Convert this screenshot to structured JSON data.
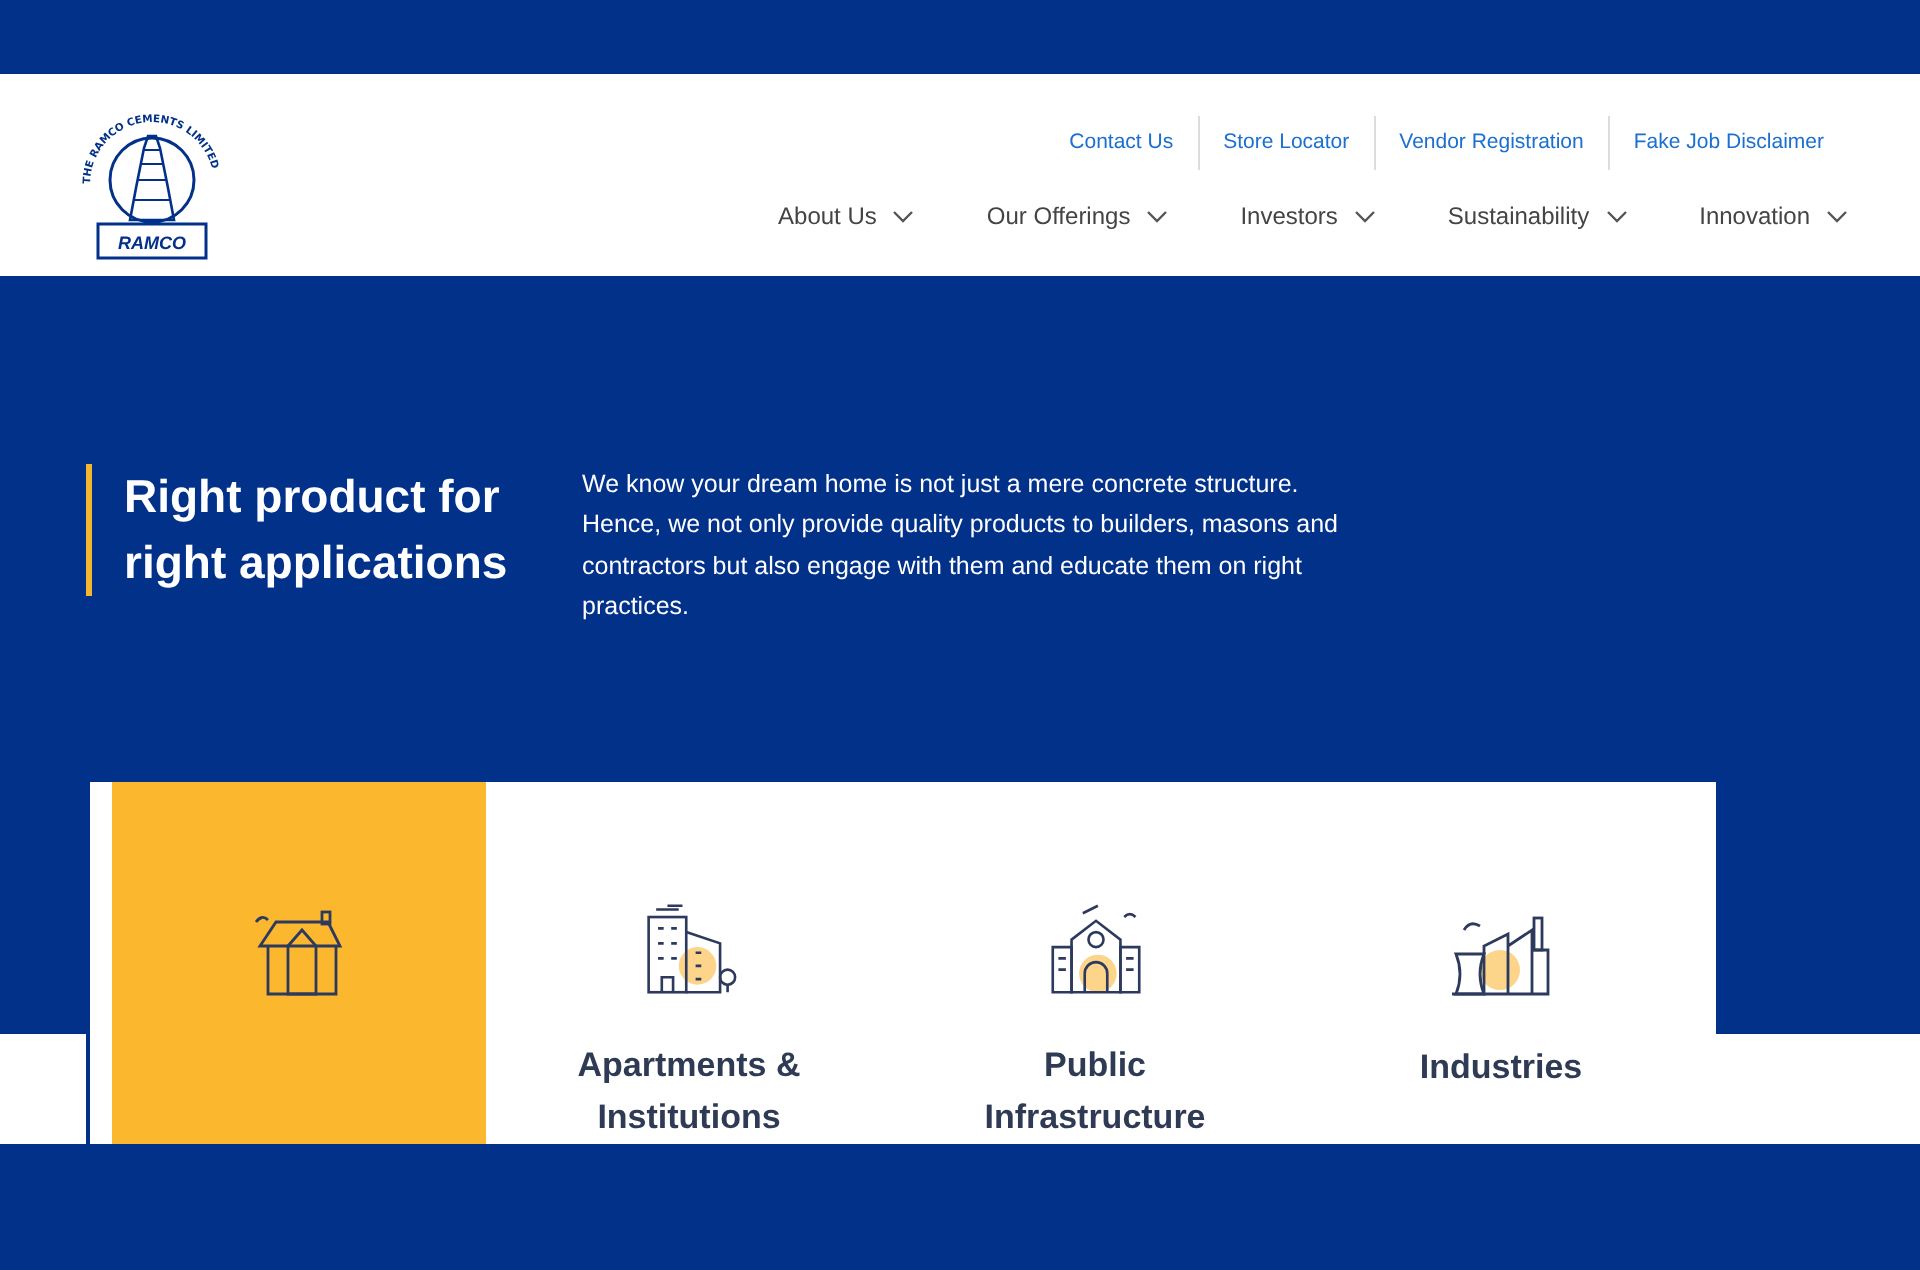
{
  "logo": {
    "ring_text": "THE RAMCO CEMENTS LIMITED",
    "name": "RAMCO"
  },
  "top_links": [
    "Contact Us",
    "Store Locator",
    "Vendor Registration",
    "Fake Job Disclaimer"
  ],
  "nav": [
    {
      "label": "About Us"
    },
    {
      "label": "Our Offerings"
    },
    {
      "label": "Investors"
    },
    {
      "label": "Sustainability"
    },
    {
      "label": "Innovation"
    }
  ],
  "hero": {
    "heading": "Right product for right applications",
    "text": "We know your dream home is not just a mere concrete structure. Hence, we not only provide quality products to builders, masons and contractors but also engage with them and educate them on right practices."
  },
  "categories": [
    {
      "kind": "house",
      "selected": true
    },
    {
      "kind": "apartments",
      "label": "Apartments & Institutions",
      "selected": false
    },
    {
      "kind": "infrastructure",
      "label": "Public Infrastructure",
      "selected": false
    },
    {
      "kind": "industry",
      "label": "Industries",
      "selected": false
    }
  ]
}
